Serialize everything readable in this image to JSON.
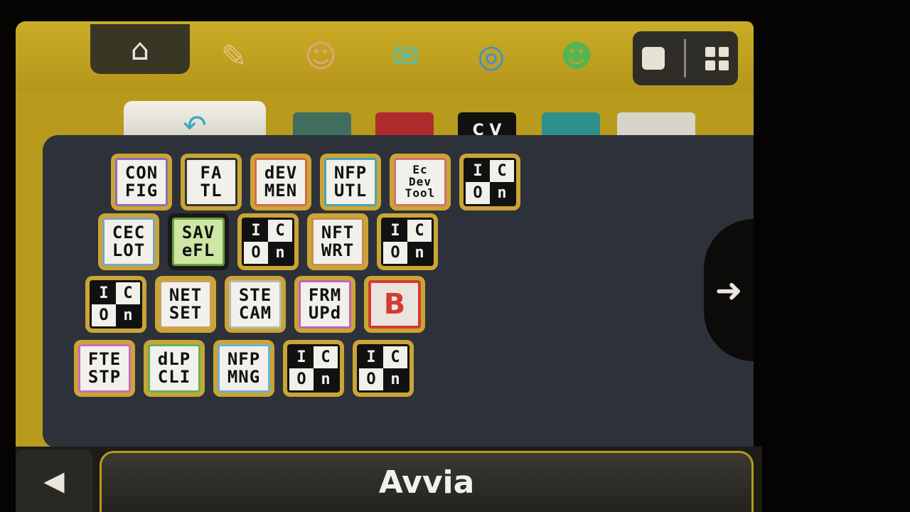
{
  "top_bar": {
    "icons": [
      {
        "name": "home-settings-icon",
        "glyph": "⌂"
      },
      {
        "name": "pencil-icon",
        "glyph": "✎",
        "color": "#e4c37a"
      },
      {
        "name": "smiley-icon",
        "glyph": "☺",
        "color": "#e4a27a"
      },
      {
        "name": "chat-bubble-icon",
        "glyph": "✉",
        "color": "#4fc2b5"
      },
      {
        "name": "globe-icon",
        "glyph": "◎",
        "color": "#3a8fd8"
      },
      {
        "name": "friends-icon",
        "glyph": "☻",
        "color": "#54b552"
      }
    ]
  },
  "row2": {
    "back_glyph": "↶",
    "cv_label": "C V"
  },
  "folder": {
    "apps": [
      {
        "lines": [
          "CON",
          "FIG"
        ],
        "border": "#8a6fb8"
      },
      {
        "lines": [
          "FA",
          "TL"
        ],
        "border": "#333333"
      },
      {
        "lines": [
          "dEV",
          "MEN"
        ],
        "border": "#d8694a"
      },
      {
        "lines": [
          "NFP",
          "UTL"
        ],
        "border": "#4aa3b5"
      },
      {
        "lines": [
          "Ec",
          "Dev",
          "Tool"
        ],
        "border": "#d6706e",
        "small": true
      },
      {
        "placeholder": true
      },
      {
        "lines": [
          "CEC",
          "LOT"
        ],
        "border": "#7aa6c9"
      },
      {
        "lines": [
          "SAV",
          "eFL"
        ],
        "border": "#6aa144",
        "selected": true
      },
      {
        "placeholder": true
      },
      {
        "lines": [
          "NFT",
          "WRT"
        ],
        "border": "#c98d52"
      },
      {
        "placeholder": true
      },
      {
        "placeholder": true
      },
      {
        "lines": [
          "NET",
          "SET"
        ],
        "border": "#c9a062"
      },
      {
        "lines": [
          "STE",
          "CAM"
        ],
        "border": "#b8b8b8"
      },
      {
        "lines": [
          "FRM",
          "UPd"
        ],
        "border": "#c162b8"
      },
      {
        "badge": "B"
      },
      {
        "lines": [
          "FTE",
          "STP"
        ],
        "border": "#c66fb9"
      },
      {
        "lines": [
          "dLP",
          "CLI"
        ],
        "border": "#5fb55c"
      },
      {
        "lines": [
          "NFP",
          "MNG"
        ],
        "border": "#6ab0d8"
      },
      {
        "placeholder": true
      },
      {
        "placeholder": true
      }
    ],
    "placeholder_glyphs": [
      "I",
      "C",
      "O",
      "n"
    ]
  },
  "nav": {
    "next_glyph": "➜",
    "prev_glyph": "◀"
  },
  "launch_label": "Avvia"
}
